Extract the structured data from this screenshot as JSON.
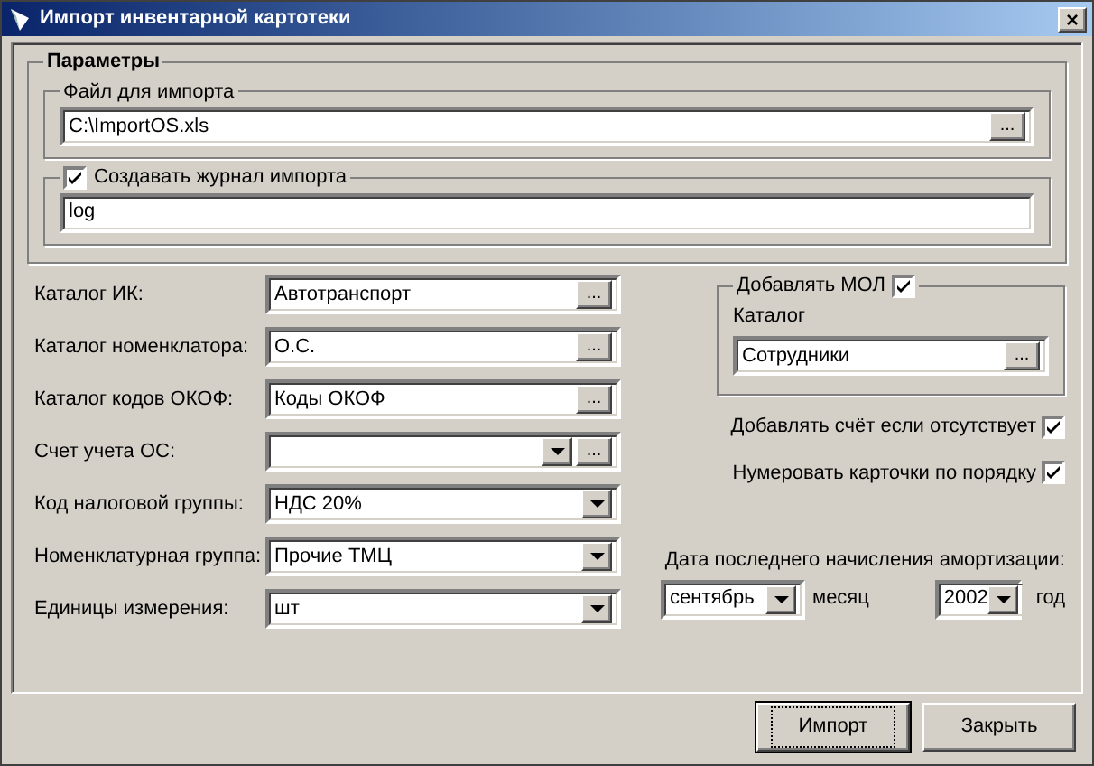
{
  "window": {
    "title": "Импорт инвентарной картотеки",
    "close": "×"
  },
  "parameters": {
    "title": "Параметры",
    "file_group": {
      "label": "Файл для импорта",
      "value": "C:\\ImportOS.xls",
      "button": "..."
    },
    "log_group": {
      "label": "Создавать журнал импорта",
      "checked": true,
      "value": "log"
    }
  },
  "fields": [
    {
      "label": "Каталог ИК:",
      "kind": "browse",
      "value": "Автотранспорт",
      "button": "..."
    },
    {
      "label": "Каталог номенклатора:",
      "kind": "browse",
      "value": "О.С.",
      "button": "..."
    },
    {
      "label": "Каталог кодов ОКОФ:",
      "kind": "browse",
      "value": "Коды ОКОФ",
      "button": "..."
    },
    {
      "label": "Счет учета ОС:",
      "kind": "combo_browse",
      "button": "..."
    },
    {
      "label": "Код налоговой группы:",
      "kind": "combo",
      "value": "НДС 20%"
    },
    {
      "label": "Номенклатурная группа:",
      "kind": "combo",
      "value": "Прочие ТМЦ"
    },
    {
      "label": "Единицы измерения:",
      "kind": "combo",
      "value": "шт"
    }
  ],
  "mol_group": {
    "label": "Добавлять МОЛ",
    "checked": true,
    "catalog_label": "Каталог",
    "value": "Сотрудники",
    "button": "..."
  },
  "options": [
    {
      "label": "Добавлять счёт если отсутствует",
      "checked": true
    },
    {
      "label": "Нумеровать карточки по порядку",
      "checked": true
    }
  ],
  "date": {
    "label": "Дата последнего начисления амортизации:",
    "month": "сентябрь",
    "month_unit": "месяц",
    "year": "2002",
    "year_unit": "год"
  },
  "buttons": [
    {
      "label": "Импорт",
      "selected": true
    },
    {
      "label": "Закрыть",
      "selected": false
    }
  ]
}
